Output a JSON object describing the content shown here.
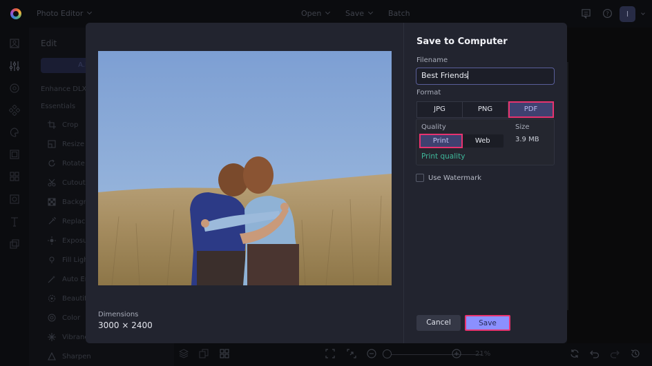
{
  "topbar": {
    "app_title": "Photo Editor",
    "menu": [
      {
        "label": "Open",
        "has_dropdown": true
      },
      {
        "label": "Save",
        "has_dropdown": true
      },
      {
        "label": "Batch",
        "has_dropdown": false
      }
    ],
    "icons": [
      "chat-icon",
      "help-icon"
    ],
    "avatar_initial": "I"
  },
  "rail": {
    "icons": [
      "image-icon",
      "adjust-sliders-icon",
      "eye-icon",
      "effects-icon",
      "palette-icon",
      "frame-icon",
      "grid-icon",
      "overlay-icon",
      "text-icon",
      "graphics-icon"
    ]
  },
  "edit_panel": {
    "title": "Edit",
    "ai_button": "A.I. Im",
    "enhance_label": "Enhance DLX",
    "essentials_label": "Essentials",
    "tools": [
      {
        "label": "Crop",
        "icon": "crop-icon"
      },
      {
        "label": "Resize",
        "icon": "resize-icon"
      },
      {
        "label": "Rotate",
        "icon": "rotate-icon"
      },
      {
        "label": "Cutout",
        "icon": "scissors-icon"
      },
      {
        "label": "Backgro",
        "icon": "checker-icon"
      },
      {
        "label": "Replace",
        "icon": "dropper-icon"
      },
      {
        "label": "Exposu",
        "icon": "sun-icon"
      },
      {
        "label": "Fill Ligh",
        "icon": "bulb-icon"
      },
      {
        "label": "Auto En",
        "icon": "wand-icon"
      },
      {
        "label": "Beautify",
        "icon": "flower-icon"
      },
      {
        "label": "Color",
        "icon": "color-wheel-icon"
      },
      {
        "label": "Vibranc",
        "icon": "sparkle-icon"
      },
      {
        "label": "Sharpen",
        "icon": "triangle-icon"
      }
    ]
  },
  "bottombar": {
    "zoom_percent": "21%",
    "zoom_level_fraction": 0.0
  },
  "modal": {
    "title": "Save to Computer",
    "filename_label": "Filename",
    "filename_value": "Best Friends",
    "format_label": "Format",
    "formats": [
      {
        "label": "JPG",
        "selected": false
      },
      {
        "label": "PNG",
        "selected": false
      },
      {
        "label": "PDF",
        "selected": true
      }
    ],
    "quality_label": "Quality",
    "quality_options": [
      {
        "label": "Print",
        "selected": true
      },
      {
        "label": "Web",
        "selected": false
      }
    ],
    "quality_hint": "Print quality",
    "size_label": "Size",
    "size_value": "3.9 MB",
    "watermark_label": "Use Watermark",
    "watermark_checked": false,
    "dimensions_label": "Dimensions",
    "dimensions_value": "3000 × 2400",
    "cancel_label": "Cancel",
    "save_label": "Save"
  },
  "colors": {
    "accent": "#8b90ff",
    "highlight": "#e9336f",
    "selected_segment": "#3f4170",
    "hint_green": "#3fb89b"
  }
}
